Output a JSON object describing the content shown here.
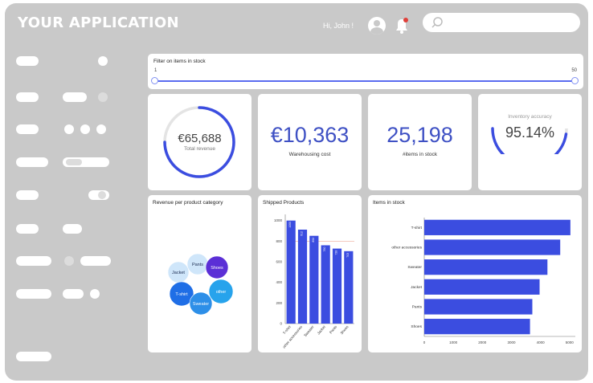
{
  "app": {
    "title": "YOUR APPLICATION",
    "greeting": "Hi, John !",
    "search_placeholder": ""
  },
  "filter": {
    "label": "Filter on items in stock",
    "min": "1",
    "max": "50",
    "range": [
      1,
      50
    ]
  },
  "kpis": {
    "total_revenue": {
      "value": "€65,688",
      "label": "Total revenue",
      "gauge_fraction": 0.75
    },
    "warehousing": {
      "value": "€10,363",
      "label": "Warehousing cost"
    },
    "items_in_stock": {
      "value": "25,198",
      "label": "#items in stock"
    },
    "inventory_accuracy": {
      "value": "95.14%",
      "label": "Inventory accuracy",
      "gauge_fraction": 0.9514
    }
  },
  "colors": {
    "accent": "#3f51c4",
    "bar": "#3b4de0",
    "gauge_track": "#e4e4e4",
    "background": "#c9c9c9"
  },
  "chart_data": [
    {
      "type": "bubble",
      "title": "Revenue per product category",
      "categories": [
        "Pants",
        "Shoes",
        "Jacket",
        "other",
        "T-shirt",
        "Sweater"
      ],
      "colors": [
        "#cfe6fa",
        "#5b2fd6",
        "#cfe6fa",
        "#27a3ec",
        "#1f6ee6",
        "#2d8fe8"
      ]
    },
    {
      "type": "bar",
      "title": "Shipped Products",
      "categories": [
        "T-shirt",
        "other accessories",
        "Sweater",
        "Jacket",
        "Pants",
        "Shoes"
      ],
      "values": [
        1000,
        912,
        852,
        760,
        728,
        703
      ],
      "data_labels": [
        "1000",
        "912",
        "852",
        "760",
        "728",
        "703"
      ],
      "yticks": [
        "0",
        "200",
        "400",
        "600",
        "800",
        "1000"
      ],
      "ylim": [
        0,
        1060
      ],
      "reference_line": 800
    },
    {
      "type": "bar",
      "orientation": "horizontal",
      "title": "Items in stock",
      "categories": [
        "T-shirt",
        "other accessories",
        "Sweater",
        "Jacket",
        "Pants",
        "Shoes"
      ],
      "values": [
        5030,
        4680,
        4240,
        3970,
        3720,
        3640
      ],
      "xticks": [
        "0",
        "1000",
        "2000",
        "3000",
        "4000",
        "5000"
      ],
      "xlim": [
        0,
        5200
      ]
    }
  ]
}
